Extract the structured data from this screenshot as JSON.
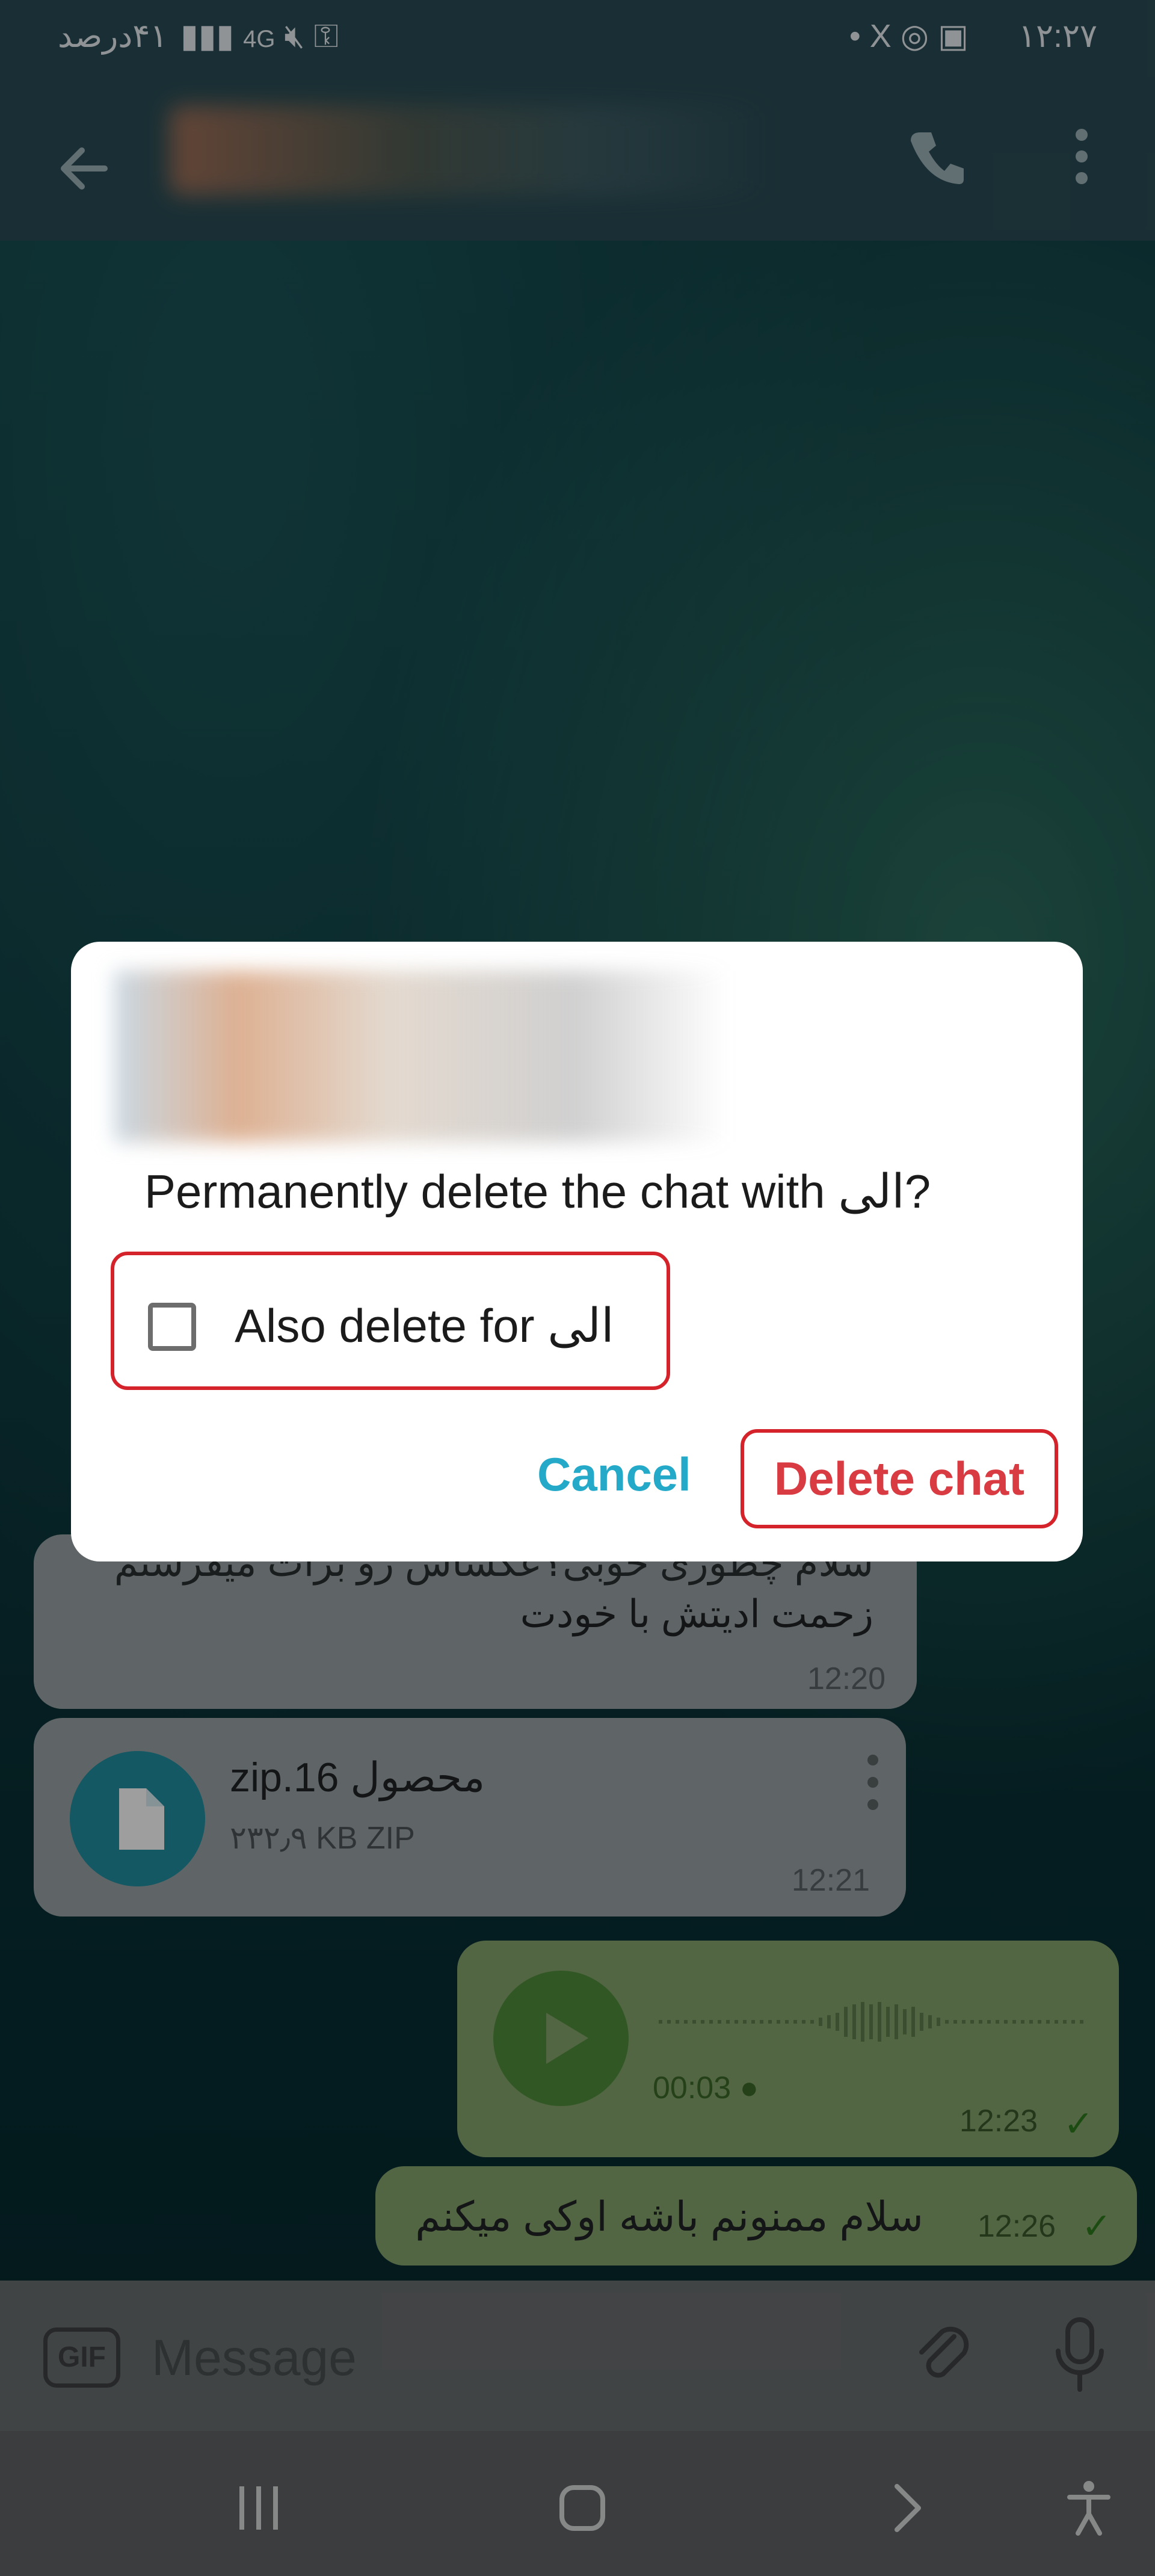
{
  "status_bar": {
    "left_text": "۴۱درصد",
    "right_time": "۱۲:۲۷",
    "icons": [
      "battery-icon",
      "signal-icon",
      "4g-icon",
      "mute-icon",
      "key-icon",
      "dot-icon",
      "x-icon",
      "instagram-icon",
      "image-icon"
    ]
  },
  "app_bar": {
    "icons": [
      "back-arrow-icon",
      "phone-icon",
      "more-vert-icon"
    ]
  },
  "chat": {
    "messages": [
      {
        "text_line1": "سلام چطوری خوبی؟عکساش رو برات میفرستم",
        "text_line2": "زحمت ادیتش با خودت",
        "time": "12:20"
      },
      {
        "file_name": "zip.محصول 16",
        "file_meta": "۲۳۲٫۹ KB ZIP",
        "time": "12:21"
      },
      {
        "duration": "00:03",
        "time": "12:23"
      },
      {
        "text": "سلام ممنونم باشه اوکی میکنم",
        "time": "12:26"
      }
    ]
  },
  "dialog": {
    "prompt": "Permanently delete the chat with الی?",
    "checkbox_label": "Also delete for الی",
    "cancel_label": "Cancel",
    "delete_label": "Delete chat",
    "colors": {
      "accent": "#24a9c8",
      "danger": "#d93b43"
    }
  },
  "input_bar": {
    "gif_label": "GIF",
    "placeholder": "Message"
  },
  "nav_bar": {
    "icons": [
      "recents-icon",
      "home-icon",
      "back-nav-icon",
      "accessibility-icon"
    ]
  }
}
